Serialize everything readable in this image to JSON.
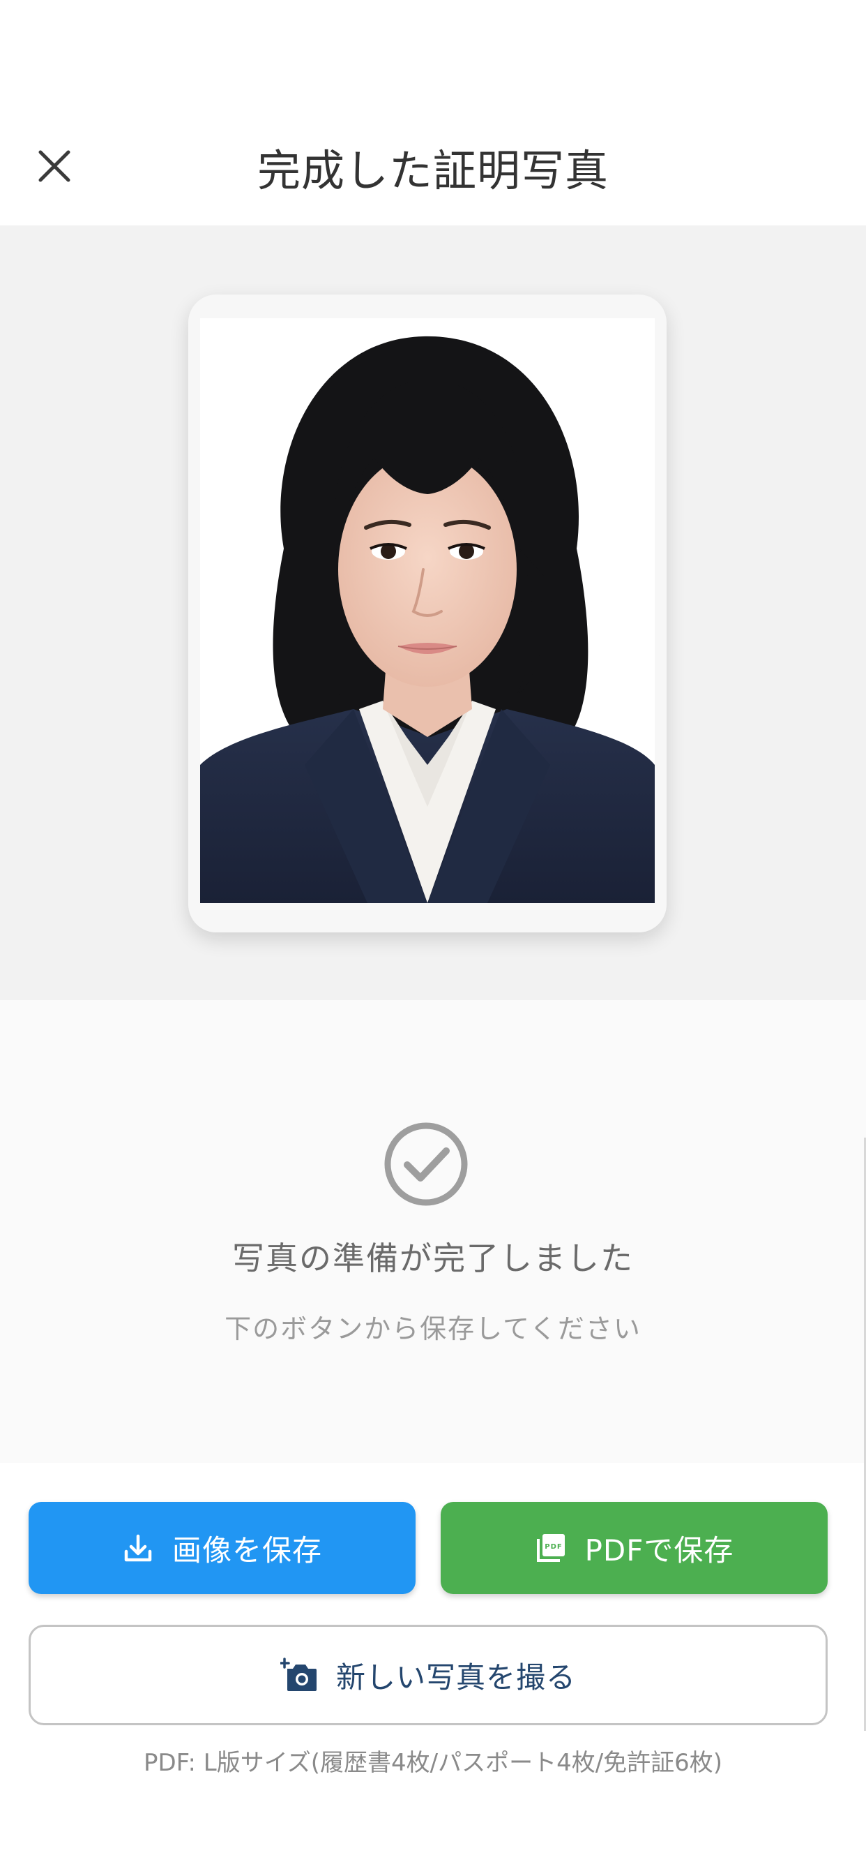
{
  "header": {
    "title": "完成した証明写真",
    "close_icon": "close-icon"
  },
  "preview": {
    "photo_alt": "ID photo of a woman in a dark navy suit on a white background"
  },
  "status": {
    "icon": "check-circle-icon",
    "title": "写真の準備が完了しました",
    "subtitle": "下のボタンから保存してください"
  },
  "actions": {
    "save_image": {
      "label": "画像を保存",
      "icon": "download-icon",
      "color": "#2196f3"
    },
    "save_pdf": {
      "label": "PDFで保存",
      "icon": "pdf-icon",
      "color": "#4caf50"
    },
    "new_photo": {
      "label": "新しい写真を撮る",
      "icon": "add-camera-icon",
      "color": "#24466e"
    },
    "footnote": "PDF: L版サイズ(履歴書4枚/パスポート4枚/免許証6枚)"
  }
}
